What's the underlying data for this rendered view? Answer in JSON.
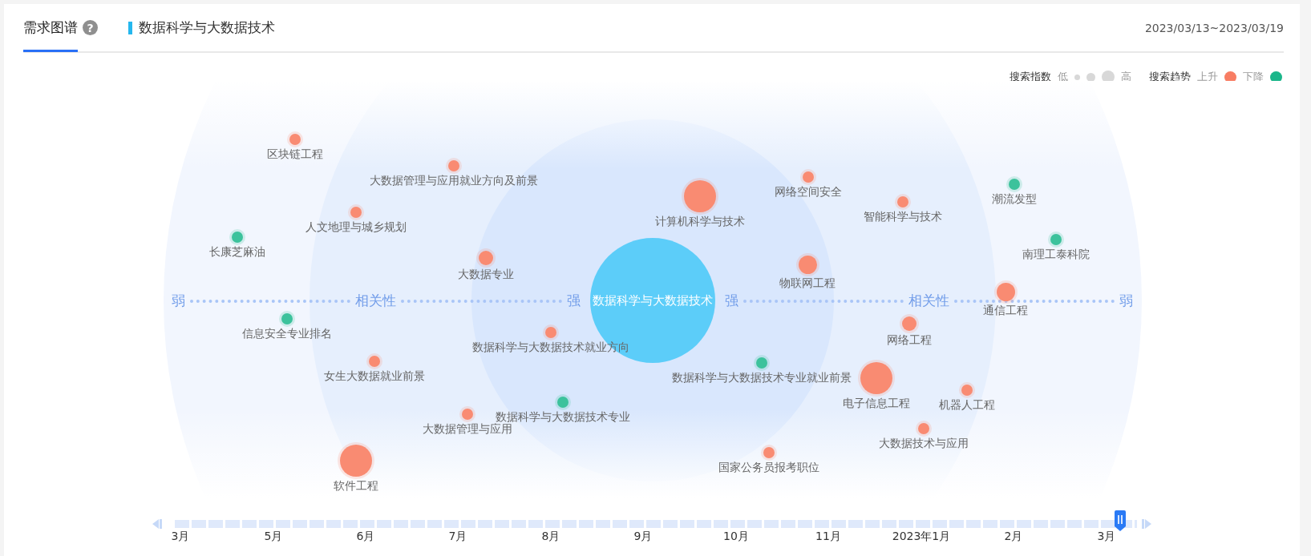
{
  "tabs": [
    {
      "label": "需求图谱",
      "selected": true,
      "help": "?"
    }
  ],
  "keyword": "数据科学与大数据技术",
  "date_range": "2023/03/13~2023/03/19",
  "legend": {
    "index_title": "搜索指数",
    "low": "低",
    "high": "高",
    "trend_title": "搜索趋势",
    "items": [
      {
        "label": "上升",
        "color": "#f87d63"
      },
      {
        "label": "下降",
        "color": "#1bb68a"
      }
    ]
  },
  "axis": {
    "left_weak": "弱",
    "left_relevance": "相关性",
    "left_strong": "强",
    "right_strong": "强",
    "right_relevance": "相关性",
    "right_weak": "弱"
  },
  "center": "数据科学与大数据技术",
  "nodes": [
    {
      "label": "区块链工程",
      "color": "#f98b72",
      "kind": "small"
    },
    {
      "label": "大数据管理与应用就业方向及前景",
      "color": "#f98b72",
      "kind": "small"
    },
    {
      "label": "人文地理与城乡规划",
      "color": "#f98b72",
      "kind": "small"
    },
    {
      "label": "长康芝麻油",
      "color": "#3cc29c",
      "kind": "small"
    },
    {
      "label": "大数据专业",
      "color": "#f98b72",
      "kind": "medium"
    },
    {
      "label": "计算机科学与技术",
      "color": "#f98b72",
      "kind": "xlarge"
    },
    {
      "label": "网络空间安全",
      "color": "#f98b72",
      "kind": "small"
    },
    {
      "label": "智能科学与技术",
      "color": "#f98b72",
      "kind": "small"
    },
    {
      "label": "潮流发型",
      "color": "#3cc29c",
      "kind": "small"
    },
    {
      "label": "南理工泰科院",
      "color": "#3cc29c",
      "kind": "small"
    },
    {
      "label": "物联网工程",
      "color": "#f98b72",
      "kind": "large"
    },
    {
      "label": "通信工程",
      "color": "#f98b72",
      "kind": "large"
    },
    {
      "label": "信息安全专业排名",
      "color": "#3cc29c",
      "kind": "small"
    },
    {
      "label": "数据科学与大数据技术就业方向",
      "color": "#f98b72",
      "kind": "small"
    },
    {
      "label": "网络工程",
      "color": "#f98b72",
      "kind": "medium"
    },
    {
      "label": "女生大数据就业前景",
      "color": "#f98b72",
      "kind": "small"
    },
    {
      "label": "数据科学与大数据技术专业就业前景",
      "color": "#3cc29c",
      "kind": "small"
    },
    {
      "label": "电子信息工程",
      "color": "#f98b72",
      "kind": "xlarge"
    },
    {
      "label": "机器人工程",
      "color": "#f98b72",
      "kind": "small"
    },
    {
      "label": "数据科学与大数据技术专业",
      "color": "#3cc29c",
      "kind": "small"
    },
    {
      "label": "大数据管理与应用",
      "color": "#f98b72",
      "kind": "small"
    },
    {
      "label": "大数据技术与应用",
      "color": "#f98b72",
      "kind": "small"
    },
    {
      "label": "国家公务员报考职位",
      "color": "#f98b72",
      "kind": "small"
    },
    {
      "label": "软件工程",
      "color": "#f98b72",
      "kind": "xlarge"
    }
  ],
  "timeline": {
    "level": 0.983,
    "months": [
      "3月",
      "5月",
      "6月",
      "7月",
      "8月",
      "9月",
      "10月",
      "11月",
      "2023年1月",
      "2月",
      "3月"
    ]
  }
}
